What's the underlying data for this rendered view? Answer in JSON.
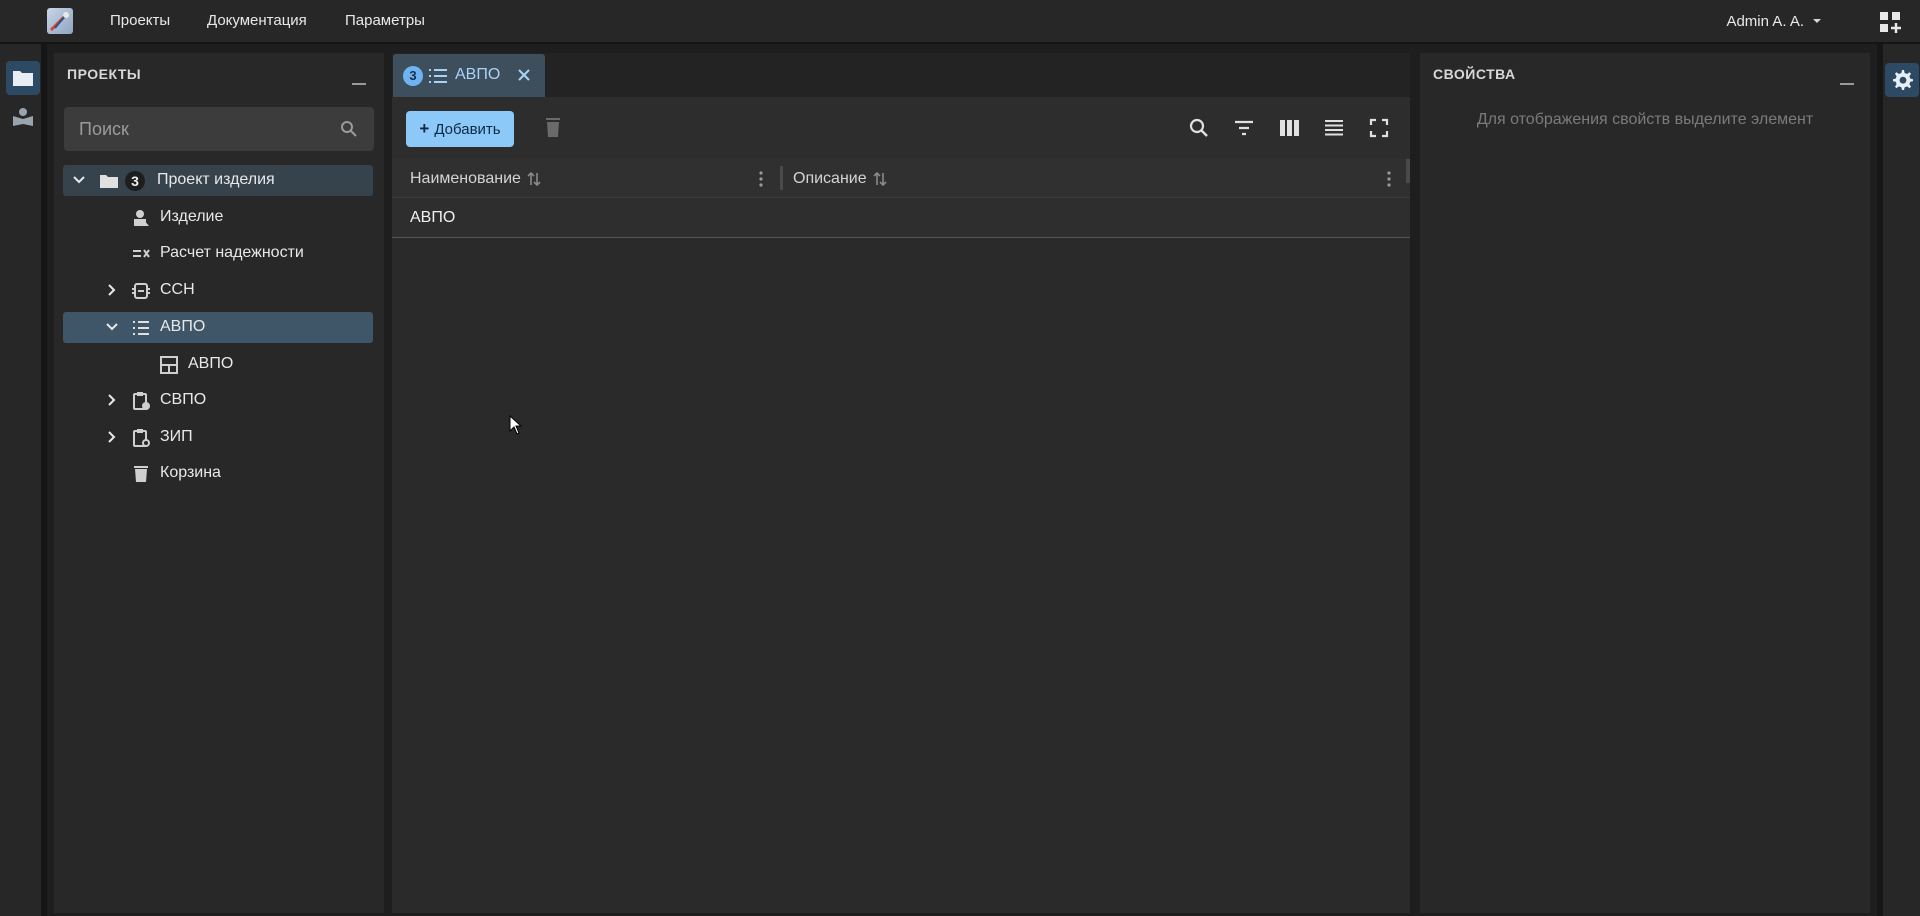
{
  "topbar": {
    "nav": [
      "Проекты",
      "Документация",
      "Параметры"
    ],
    "user": "Admin A. A.",
    "icons": {
      "logo": "app-logo",
      "user_dropdown": "caret-down-icon",
      "apps": "apps-add-icon"
    }
  },
  "rail": {
    "items": [
      {
        "icon": "folder-icon",
        "active": true
      },
      {
        "icon": "reader-icon",
        "active": false
      }
    ]
  },
  "projects_panel": {
    "title": "ПРОЕКТЫ",
    "search_placeholder": "Поиск",
    "tree": [
      {
        "label": "Проект изделия",
        "badge": "3",
        "icon": "folder-icon",
        "expanded": true,
        "level": 0
      },
      {
        "label": "Изделие",
        "icon": "product-icon",
        "level": 1
      },
      {
        "label": "Расчет надежности",
        "icon": "checklist-icon",
        "level": 1
      },
      {
        "label": "ССН",
        "icon": "ssn-icon",
        "expanded": false,
        "level": 1
      },
      {
        "label": "АВПО",
        "icon": "list-icon",
        "expanded": true,
        "selected": true,
        "level": 1
      },
      {
        "label": "АВПО",
        "icon": "table-icon",
        "level": 2
      },
      {
        "label": "СВПО",
        "icon": "clipboard-icon",
        "expanded": false,
        "level": 1
      },
      {
        "label": "ЗИП",
        "icon": "clipboard-gear-icon",
        "expanded": false,
        "level": 1
      },
      {
        "label": "Корзина",
        "icon": "trash-icon",
        "level": 1
      }
    ]
  },
  "tabs": [
    {
      "badge": "3",
      "label": "АВПО",
      "icon": "list-icon",
      "active": true
    }
  ],
  "toolbar": {
    "add_label": "Добавить",
    "icons": [
      "delete-icon",
      "search-icon",
      "filter-icon",
      "columns-icon",
      "density-icon",
      "fullscreen-icon"
    ]
  },
  "table": {
    "columns": [
      "Наименование",
      "Описание"
    ],
    "rows": [
      [
        "АВПО",
        ""
      ]
    ]
  },
  "properties_panel": {
    "title": "СВОЙСТВА",
    "empty_text": "Для отображения свойств выделите элемент"
  },
  "colors": {
    "accent": "#8cc8f8",
    "selected_row": "#3e5668",
    "background": "#1e1e1e",
    "panel": "#282828"
  }
}
